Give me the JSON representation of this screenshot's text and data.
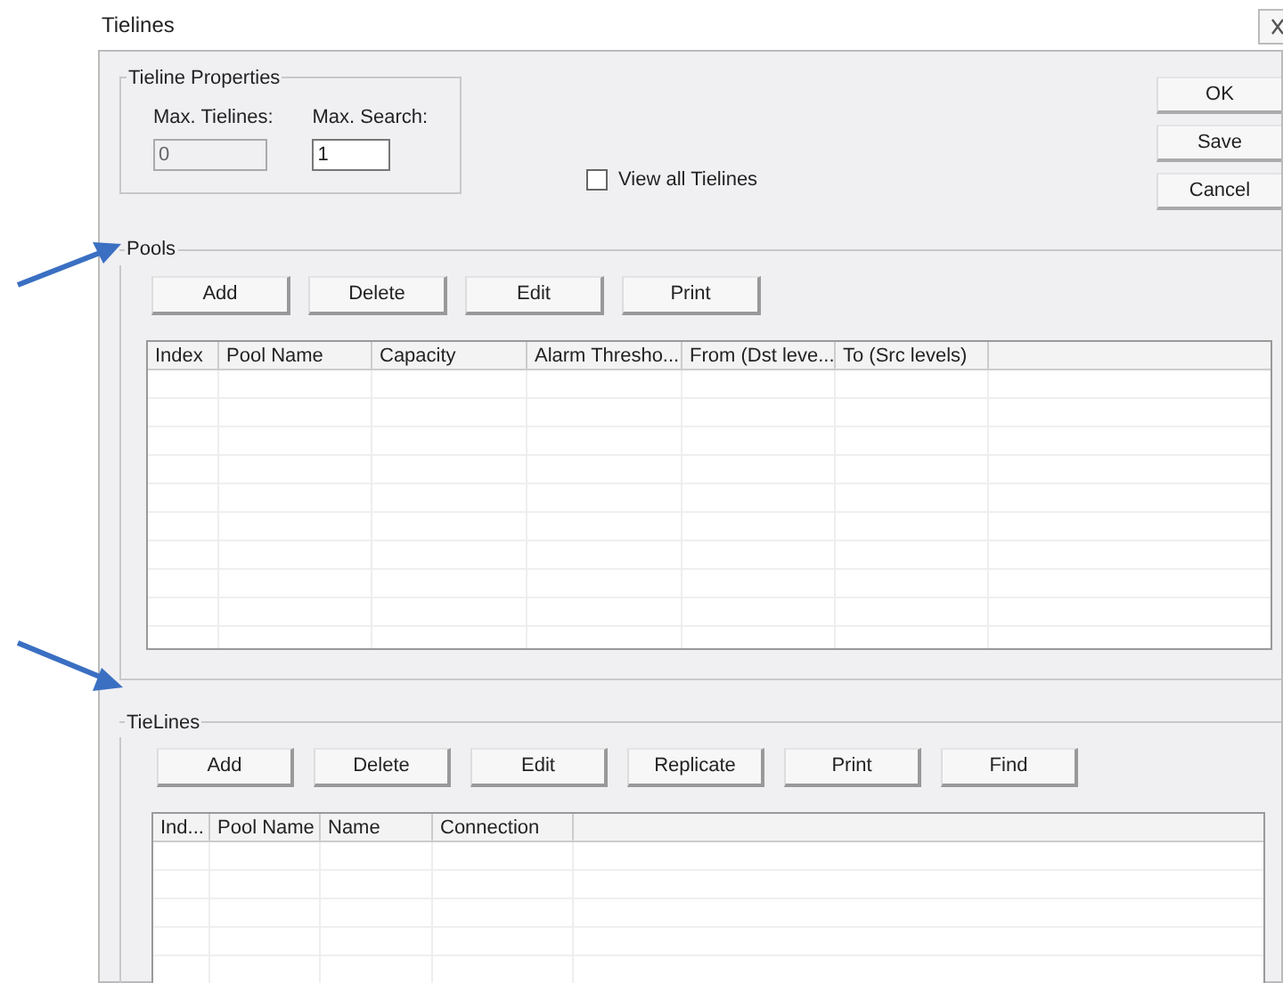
{
  "window": {
    "title": "Tielines"
  },
  "tieline_properties": {
    "title": "Tieline Properties",
    "fields": [
      {
        "label": "Max. Tielines:",
        "value": "0",
        "disabled": true
      },
      {
        "label": "Max. Search:",
        "value": "1",
        "disabled": false
      }
    ]
  },
  "view_all": {
    "label": "View all Tielines",
    "checked": false
  },
  "dialog_buttons": [
    "OK",
    "Save",
    "Cancel"
  ],
  "pools": {
    "title": "Pools",
    "buttons": [
      "Add",
      "Delete",
      "Edit",
      "Print"
    ],
    "columns": [
      "Index",
      "Pool Name",
      "Capacity",
      "Alarm Thresho...",
      "From (Dst leve...",
      "To (Src levels)"
    ]
  },
  "tielines": {
    "title": "TieLines",
    "buttons": [
      "Add",
      "Delete",
      "Edit",
      "Replicate",
      "Print",
      "Find"
    ],
    "columns": [
      "Ind...",
      "Pool Name",
      "Name",
      "Connection"
    ]
  }
}
